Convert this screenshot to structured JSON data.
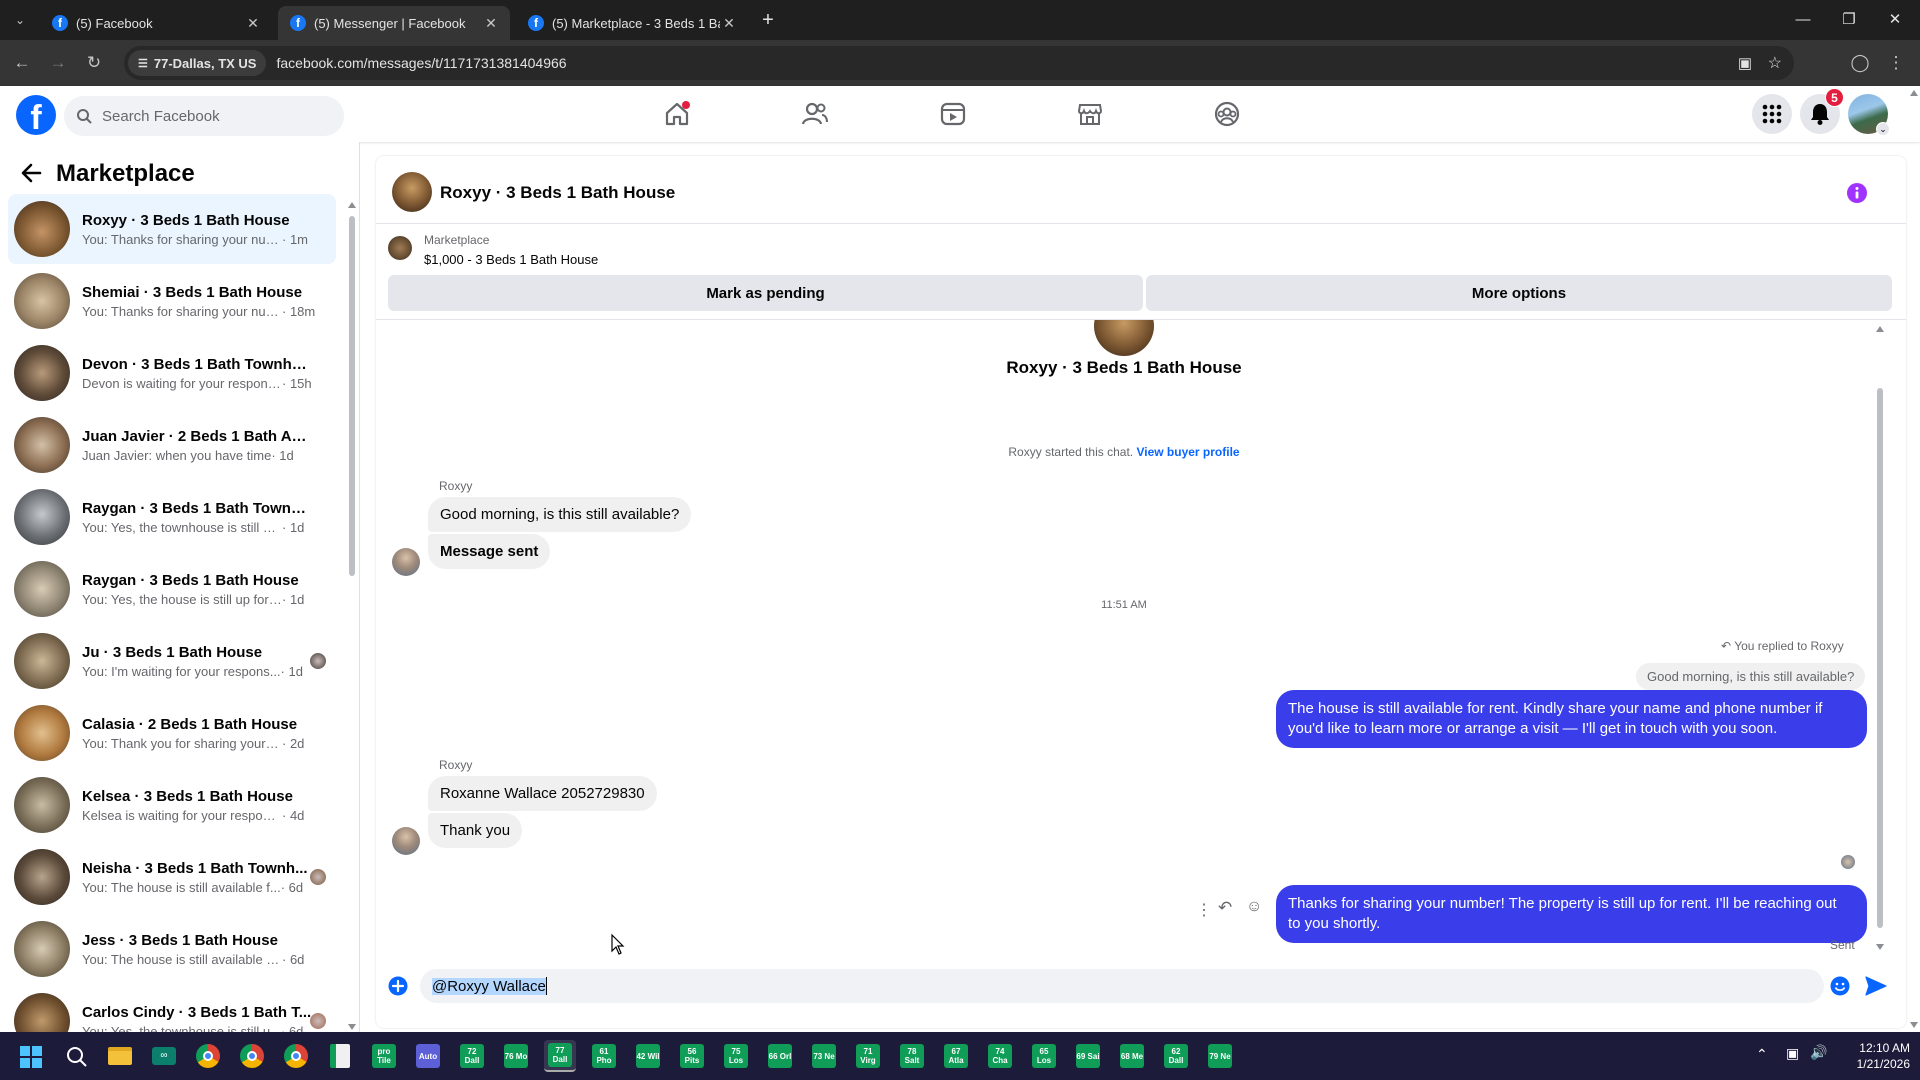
{
  "browser": {
    "tabs": [
      {
        "title": "(5) Facebook"
      },
      {
        "title": "(5) Messenger | Facebook"
      },
      {
        "title": "(5) Marketplace - 3 Beds 1 Bath"
      }
    ],
    "location": "77-Dallas, TX US",
    "url": "facebook.com/messages/t/1171731381404966"
  },
  "fb": {
    "search_placeholder": "Search Facebook",
    "notification_count": "5"
  },
  "sidebar": {
    "title": "Marketplace",
    "conversations": [
      {
        "name": "Roxyy · 3 Beds 1 Bath House",
        "preview": "You: Thanks for sharing your numb...",
        "time": "· 1m",
        "selected": true
      },
      {
        "name": "Shemiai · 3 Beds 1 Bath House",
        "preview": "You: Thanks for sharing your num...",
        "time": "· 18m"
      },
      {
        "name": "Devon · 3 Beds 1 Bath Townhouse",
        "preview": "Devon is waiting for your response.",
        "time": "· 15h"
      },
      {
        "name": "Juan Javier · 2 Beds 1 Bath Apart...",
        "preview": "Juan Javier: when you have time",
        "time": "· 1d"
      },
      {
        "name": "Raygan · 3 Beds 1 Bath Townhou...",
        "preview": "You: Yes, the townhouse is still up f...",
        "time": "· 1d"
      },
      {
        "name": "Raygan · 3 Beds 1 Bath House",
        "preview": "You: Yes, the house is still up for re...",
        "time": "· 1d"
      },
      {
        "name": "Ju · 3 Beds 1 Bath House",
        "preview": "You: I'm waiting for your respons...",
        "time": "· 1d"
      },
      {
        "name": "Calasia · 2 Beds 1 Bath House",
        "preview": "You: Thank you for sharing your co...",
        "time": "· 2d"
      },
      {
        "name": "Kelsea · 3 Beds 1 Bath House",
        "preview": "Kelsea is waiting for your response.",
        "time": "· 4d"
      },
      {
        "name": "Neisha · 3 Beds 1 Bath Townh...",
        "preview": "You: The house is still available f...",
        "time": "· 6d"
      },
      {
        "name": "Jess · 3 Beds 1 Bath House",
        "preview": "You: The house is still available for r...",
        "time": "· 6d"
      },
      {
        "name": "Carlos Cindy · 3 Beds 1 Bath T...",
        "preview": "You: Yes, the townhouse is still u...",
        "time": "· 6d"
      }
    ]
  },
  "chat": {
    "header_title": "Roxyy · 3 Beds 1 Bath House",
    "listing_label": "Marketplace",
    "listing_price_title": "$1,000 - 3 Beds 1 Bath House",
    "mark_pending": "Mark as pending",
    "more_options": "More options",
    "intro_title": "Roxyy · 3 Beds 1 Bath House",
    "started_text": "Roxyy started this chat.",
    "view_buyer": "View buyer profile",
    "sender1": "Roxyy",
    "msg1": "Good morning, is this still available?",
    "msg2": "Message sent",
    "timestamp": "11:51 AM",
    "replied_label": "You replied to Roxyy",
    "quoted": "Good morning, is this still available?",
    "reply1_line1": "The house is still available for rent. Kindly share your name and phone number if",
    "reply1_line2": "you'd like to learn more or arrange a visit — I'll get in touch with you soon.",
    "sender2": "Roxyy",
    "msg3": "Roxanne Wallace 2052729830",
    "msg4": "Thank you",
    "reply2_line1": "Thanks for sharing your number! The property is still up for rent. I'll be reaching out",
    "reply2_line2": "to you shortly.",
    "status": "Sent",
    "composer_text": "@Roxyy Wallace"
  },
  "taskbar": {
    "groups": [
      "pro Tile",
      "Auto",
      "72 Dall",
      "76 Mo",
      "77 Dall",
      "61 Pho",
      "42 Wil",
      "56 Pits",
      "75 Los",
      "66 Orl",
      "73 Ne",
      "71 Virg",
      "78 Salt",
      "67 Atla",
      "74 Cha",
      "65 Los",
      "69 Sai",
      "68 Me",
      "62 Dall",
      "79 Ne"
    ],
    "time": "12:10 AM",
    "date": "1/21/2026"
  }
}
